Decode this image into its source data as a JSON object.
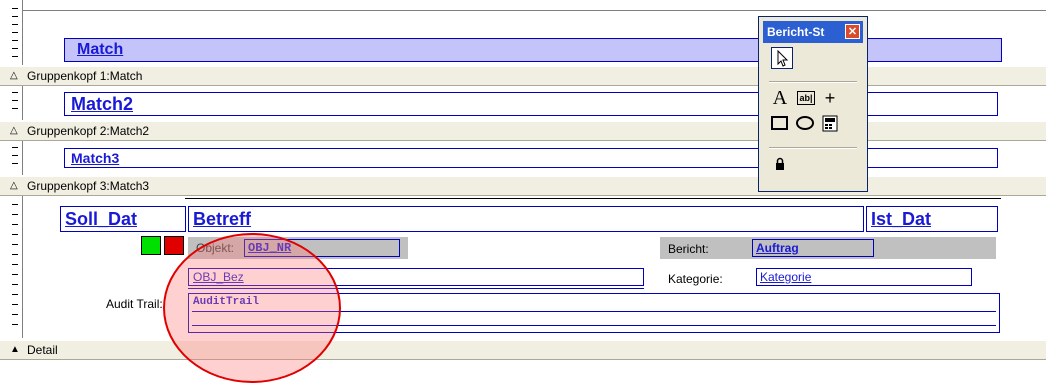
{
  "sections": {
    "group1": {
      "label": "Gruppenkopf 1:Match",
      "icon": "triangle-up-outline-icon"
    },
    "group2": {
      "label": "Gruppenkopf 2:Match2",
      "icon": "triangle-up-outline-icon"
    },
    "group3": {
      "label": "Gruppenkopf 3:Match3",
      "icon": "triangle-up-outline-icon"
    },
    "detail": {
      "label": "Detail",
      "icon": "triangle-up-filled-icon"
    }
  },
  "fields": {
    "match": "Match",
    "match2": "Match2",
    "match3": "Match3",
    "soll_dat": "Soll_Dat",
    "betreff": "Betreff",
    "ist_dat": "Ist_Dat",
    "objekt_label": "Objekt:",
    "objekt_value": "OBJ_NR",
    "obj_bez": "OBJ_Bez",
    "bericht_label": "Bericht:",
    "bericht_value": "Auftrag",
    "kategorie_label": "Kategorie:",
    "kategorie_value": "Kategorie",
    "audit_label": "Audit Trail:",
    "audit_value": "AuditTrail"
  },
  "toolbox": {
    "title": "Bericht-St",
    "close": "✕",
    "tools": [
      "pointer-arrow-icon",
      "label-A-icon",
      "textbox-ab-icon",
      "line-icon",
      "rectangle-icon",
      "ellipse-icon",
      "ole-object-icon",
      "lock-icon"
    ]
  },
  "colors": {
    "field_border": "#0000c0",
    "field_text": "#1a1ad6",
    "section_bar": "#f1efe2",
    "match_fill": "#c4c4fb",
    "gray_band": "#c0c0c0",
    "green_box": "#00e000",
    "red_box": "#e00000",
    "highlight_circle": "#e00000"
  }
}
